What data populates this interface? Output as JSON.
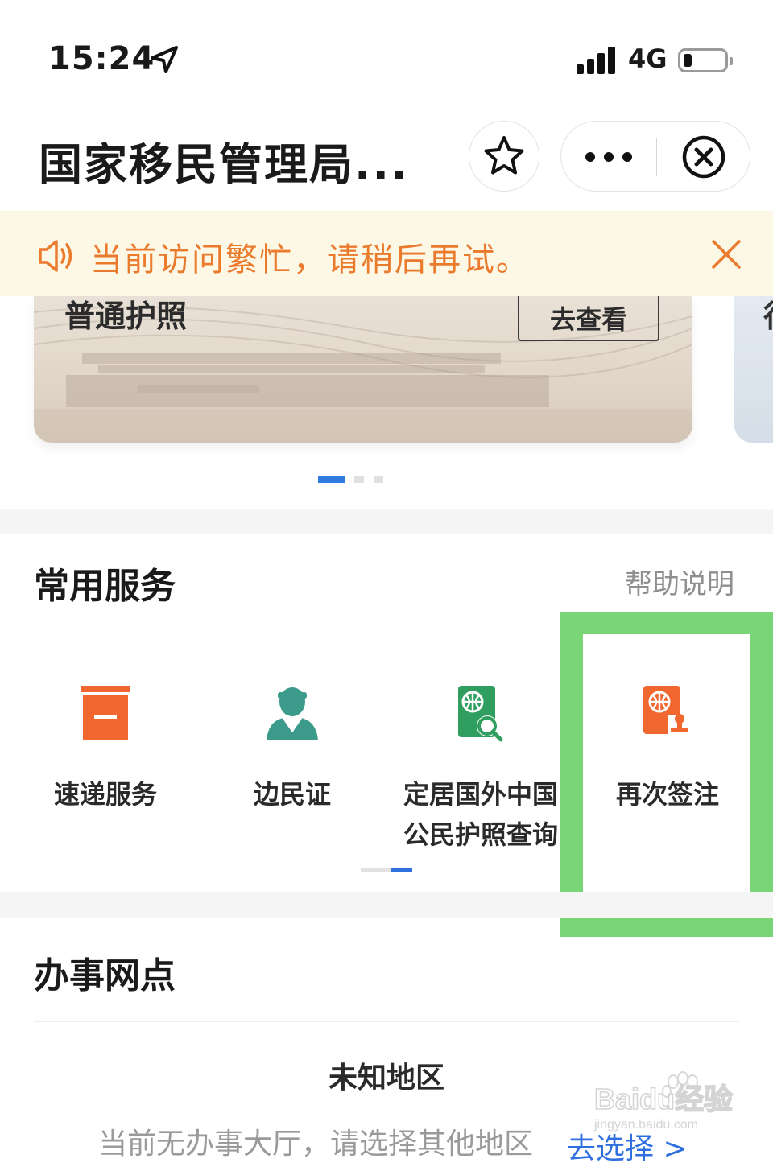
{
  "status_bar": {
    "time": "15:24",
    "network": "4G"
  },
  "title_bar": {
    "title": "国家移民管理局..."
  },
  "notice": {
    "text": "当前访问繁忙，请稍后再试。"
  },
  "carousel": {
    "card_title": "普通护照",
    "view_button": "去查看",
    "next_card_letter": "行",
    "active_index": 0,
    "count": 3
  },
  "services": {
    "title": "常用服务",
    "help": "帮助说明",
    "items": [
      {
        "label": "速递服务",
        "icon": "box-icon",
        "color": "#f0672f"
      },
      {
        "label": "边民证",
        "icon": "person-icon",
        "color": "#3b9a8a"
      },
      {
        "label": "定居国外中国公民护照查询",
        "label_line1": "定居国外中国",
        "label_line2": "公民护照查询",
        "icon": "passport-search-icon",
        "color": "#2f9e5e"
      },
      {
        "label": "再次签注",
        "icon": "passport-stamp-icon",
        "color": "#f0672f"
      }
    ],
    "highlight_color": "#79d576"
  },
  "offices": {
    "title": "办事网点",
    "region": "未知地区",
    "empty_text": "当前无办事大厅，请选择其他地区",
    "choose_link": "去选择 >"
  },
  "watermark": {
    "brand": "Baidu经验",
    "url": "jingyan.baidu.com"
  }
}
